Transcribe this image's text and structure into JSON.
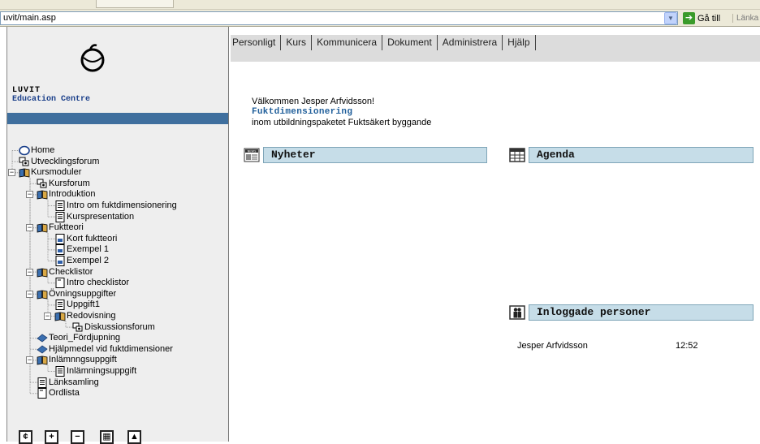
{
  "browser": {
    "address": "uvit/main.asp",
    "go_label": "Gå till",
    "links_label": "Länka"
  },
  "sidebar": {
    "logo_title": "LUVIT",
    "logo_subtitle": "Education Centre",
    "tree": [
      {
        "label": "Home",
        "icon": "home-icon"
      },
      {
        "label": "Utvecklingsforum",
        "icon": "forum-icon"
      },
      {
        "label": "Kursmoduler",
        "icon": "book-icon"
      },
      {
        "label": "Kursforum",
        "icon": "forum-icon"
      },
      {
        "label": "Introduktion",
        "icon": "book-icon"
      },
      {
        "label": "Intro om fuktdimensionering",
        "icon": "document-icon"
      },
      {
        "label": "Kurspresentation",
        "icon": "document-icon"
      },
      {
        "label": "Fuktteori",
        "icon": "book-icon"
      },
      {
        "label": "Kort fuktteori",
        "icon": "html-page-icon"
      },
      {
        "label": "Exempel 1",
        "icon": "html-page-icon"
      },
      {
        "label": "Exempel 2",
        "icon": "html-page-icon"
      },
      {
        "label": "Checklistor",
        "icon": "book-icon"
      },
      {
        "label": "Intro checklistor",
        "icon": "blank-page-icon"
      },
      {
        "label": "Övningsuppgifter",
        "icon": "book-icon"
      },
      {
        "label": "Uppgift1",
        "icon": "document-icon"
      },
      {
        "label": "Redovisning",
        "icon": "book-icon"
      },
      {
        "label": "Diskussionsforum",
        "icon": "forum-icon"
      },
      {
        "label": "Teori_Fördjupning",
        "icon": "link-icon"
      },
      {
        "label": "Hjälpmedel vid fuktdimensioner",
        "icon": "link-icon"
      },
      {
        "label": "Inlämnngsuppgift",
        "icon": "book-icon"
      },
      {
        "label": "Inlämningsuppgift",
        "icon": "document-icon"
      },
      {
        "label": "Länksamling",
        "icon": "document-icon"
      },
      {
        "label": "Ordlista",
        "icon": "blank-page-icon"
      }
    ],
    "bottom_buttons": [
      {
        "symbol": "¢",
        "icon": "refresh-icon"
      },
      {
        "symbol": "+",
        "icon": "expand-icon"
      },
      {
        "symbol": "−",
        "icon": "collapse-icon"
      },
      {
        "symbol": "▦",
        "icon": "window-icon"
      },
      {
        "symbol": "▲",
        "icon": "up-icon"
      }
    ]
  },
  "menu": [
    "Personligt",
    "Kurs",
    "Kommunicera",
    "Dokument",
    "Administrera",
    "Hjälp"
  ],
  "main": {
    "welcome": "Välkommen Jesper Arfvidsson!",
    "course_title": "Fuktdimensionering",
    "course_subtitle": "inom utbildningspaketet Fuktsäkert byggande",
    "news_header": "Nyheter",
    "agenda_header": "Agenda",
    "online_header": "Inloggade personer",
    "online_users": [
      {
        "name": "Jesper Arfvidsson",
        "time": "12:52"
      }
    ]
  },
  "colors": {
    "accent_blue": "#3f6f9e",
    "box_header_bg": "#c6dde8",
    "course_title": "#1f5e9a"
  }
}
